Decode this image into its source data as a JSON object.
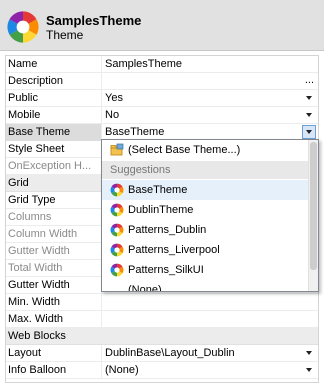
{
  "header": {
    "title": "SamplesTheme",
    "subtitle": "Theme",
    "icon": "color-wheel-icon"
  },
  "rows": {
    "name": {
      "label": "Name",
      "value": "SamplesTheme"
    },
    "description": {
      "label": "Description",
      "value": "",
      "button": "..."
    },
    "public": {
      "label": "Public",
      "value": "Yes"
    },
    "mobile": {
      "label": "Mobile",
      "value": "No"
    },
    "base_theme": {
      "label": "Base Theme",
      "value": "BaseTheme"
    },
    "style_sheet": {
      "label": "Style Sheet",
      "value": ""
    },
    "onexception": {
      "label": "OnException H...",
      "value": ""
    },
    "grid_category": {
      "label": "Grid"
    },
    "grid_type": {
      "label": "Grid Type",
      "value": ""
    },
    "columns": {
      "label": "Columns",
      "value": ""
    },
    "column_width": {
      "label": "Column Width",
      "value": ""
    },
    "gutter_width_dim": {
      "label": "Gutter Width",
      "value": ""
    },
    "total_width": {
      "label": "Total Width",
      "value": ""
    },
    "gutter_width": {
      "label": "Gutter Width",
      "value": ""
    },
    "min_width": {
      "label": "Min. Width",
      "value": ""
    },
    "max_width": {
      "label": "Max. Width",
      "value": ""
    },
    "web_blocks_category": {
      "label": "Web Blocks"
    },
    "layout": {
      "label": "Layout",
      "value": "DublinBase\\Layout_Dublin"
    },
    "info_balloon": {
      "label": "Info Balloon",
      "value": "(None)"
    }
  },
  "dropdown": {
    "select_label": "(Select Base Theme...)",
    "section_header": "Suggestions",
    "items": [
      "BaseTheme",
      "DublinTheme",
      "Patterns_Dublin",
      "Patterns_Liverpool",
      "Patterns_SilkUI",
      "(None)"
    ],
    "highlighted_index": 0
  },
  "colors": {
    "header_bg": "#e1e1e1",
    "highlight": "#e5f0fb",
    "category_bg": "#ececec",
    "accent_border": "#6c9fd4"
  }
}
